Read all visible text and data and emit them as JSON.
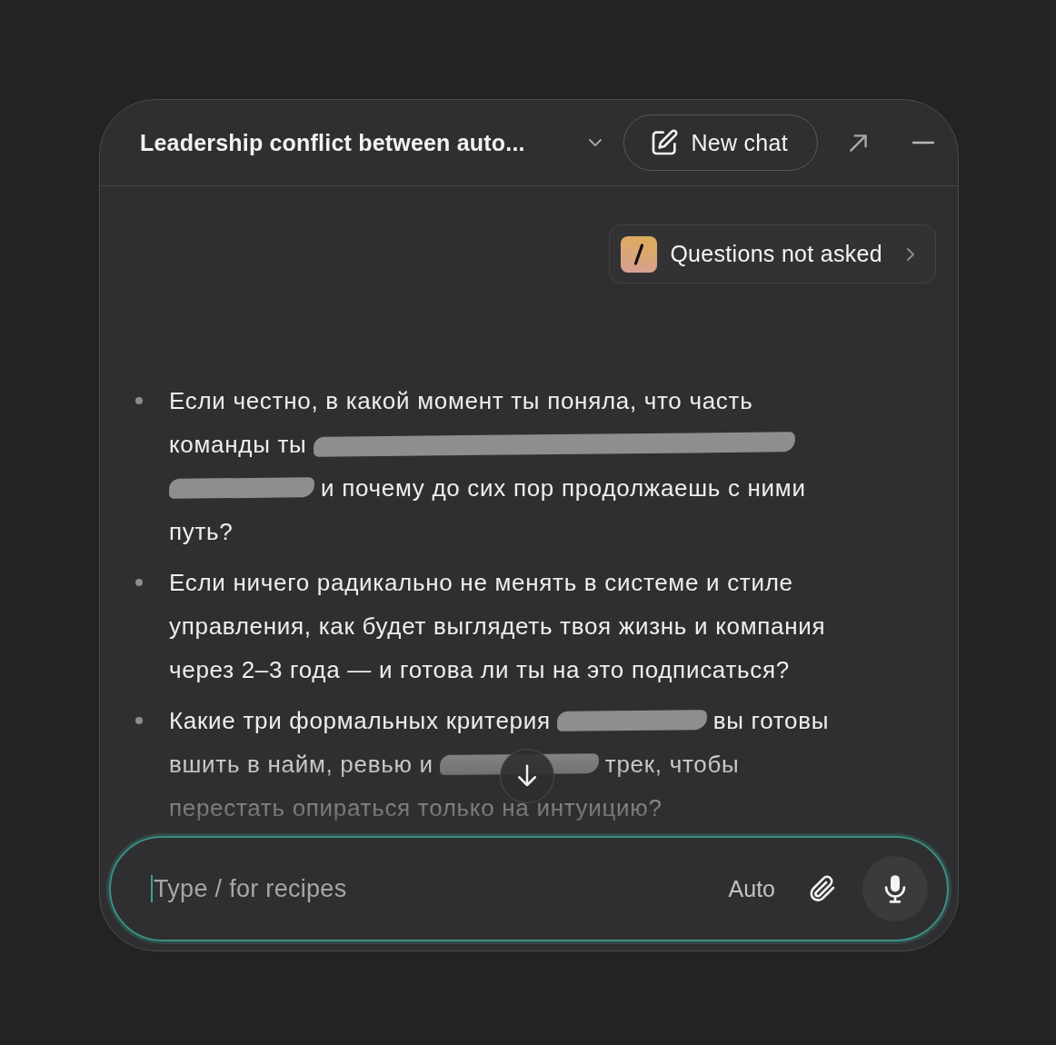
{
  "header": {
    "title": "Leadership conflict between auto...",
    "new_chat_button": "New chat"
  },
  "recipe_chip": {
    "label": "Questions not asked"
  },
  "bullets": [
    {
      "lines": [
        [
          {
            "kind": "text",
            "text": "Если честно, в какой момент ты поняла, что часть"
          }
        ],
        [
          {
            "kind": "text",
            "text": "команды ты"
          },
          {
            "kind": "redaction"
          }
        ],
        [
          {
            "kind": "redaction"
          },
          {
            "kind": "text",
            "text": "и почему до сих пор продолжаешь с ними"
          }
        ],
        [
          {
            "kind": "text",
            "text": "путь?"
          }
        ]
      ]
    },
    {
      "lines": [
        [
          {
            "kind": "text",
            "text": "Если ничего радикально не менять в системе и стиле"
          }
        ],
        [
          {
            "kind": "text",
            "text": "управления, как будет выглядеть твоя жизнь и компания"
          }
        ],
        [
          {
            "kind": "text",
            "text": "через 2–3 года — и готова ли ты на это подписаться?"
          }
        ]
      ]
    },
    {
      "lines": [
        [
          {
            "kind": "text",
            "text": "Какие три формальных критерия"
          },
          {
            "kind": "redaction"
          },
          {
            "kind": "text",
            "text": "вы готовы"
          }
        ],
        [
          {
            "kind": "text",
            "text": "вшить в найм, ревью и"
          },
          {
            "kind": "redaction"
          },
          {
            "kind": "text",
            "text": "трек, чтобы"
          }
        ],
        [
          {
            "kind": "text",
            "text": "перестать опираться только на интуицию?"
          }
        ]
      ]
    }
  ],
  "composer": {
    "placeholder": "Type / for recipes",
    "focused": true,
    "mode": "Auto"
  }
}
